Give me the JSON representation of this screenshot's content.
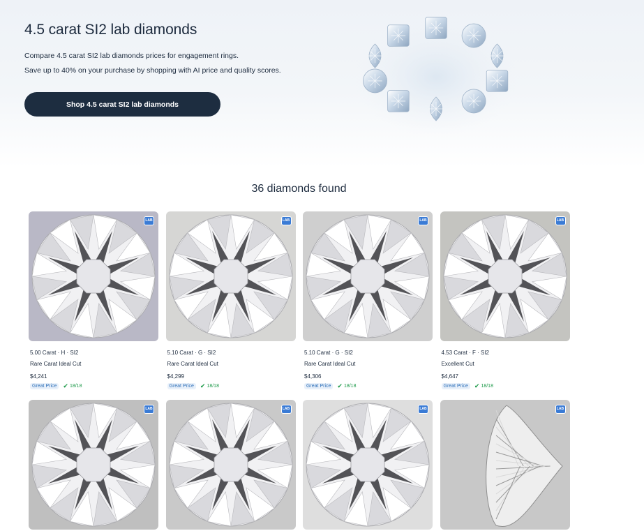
{
  "hero": {
    "title": "4.5 carat SI2 lab diamonds",
    "desc_line1": "Compare 4.5 carat SI2 lab diamonds prices for engagement rings.",
    "desc_line2": "Save up to 40% on your purchase by shopping with AI price and quality scores.",
    "shop_button": "Shop 4.5 carat SI2 lab diamonds"
  },
  "results": {
    "count_label": "36 diamonds found"
  },
  "cards": [
    {
      "lab": "LAB",
      "spec": "5.00 Carat · H · SI2",
      "cut": "Rare Carat Ideal Cut",
      "price": "$4,241",
      "badge": "Great Price",
      "score": "18/18",
      "bg": "#b9b8c6",
      "shape": "round"
    },
    {
      "lab": "LAB",
      "spec": "5.10 Carat · G · SI2",
      "cut": "Rare Carat Ideal Cut",
      "price": "$4,299",
      "badge": "Great Price",
      "score": "18/18",
      "bg": "#d6d6d4",
      "shape": "round"
    },
    {
      "lab": "LAB",
      "spec": "5.10 Carat · G · SI2",
      "cut": "Rare Carat Ideal Cut",
      "price": "$4,306",
      "badge": "Great Price",
      "score": "18/18",
      "bg": "#cfcfcf",
      "shape": "round"
    },
    {
      "lab": "LAB",
      "spec": "4.53 Carat · F · SI2",
      "cut": "Excellent Cut",
      "price": "$4,647",
      "badge": "Great Price",
      "score": "18/18",
      "bg": "#c4c4c0",
      "shape": "round"
    },
    {
      "lab": "LAB",
      "bg": "#bfbfbf",
      "shape": "round"
    },
    {
      "lab": "LAB",
      "bg": "#c9c9c9",
      "shape": "round"
    },
    {
      "lab": "LAB",
      "bg": "#dedede",
      "shape": "round"
    },
    {
      "lab": "LAB",
      "bg": "#c8c8c8",
      "shape": "pear"
    }
  ],
  "colors": {
    "button_bg": "#1d2d40",
    "lab_badge": "#3a7bd5",
    "great_price": "#2d6fb8",
    "score_green": "#1e9a4a"
  }
}
